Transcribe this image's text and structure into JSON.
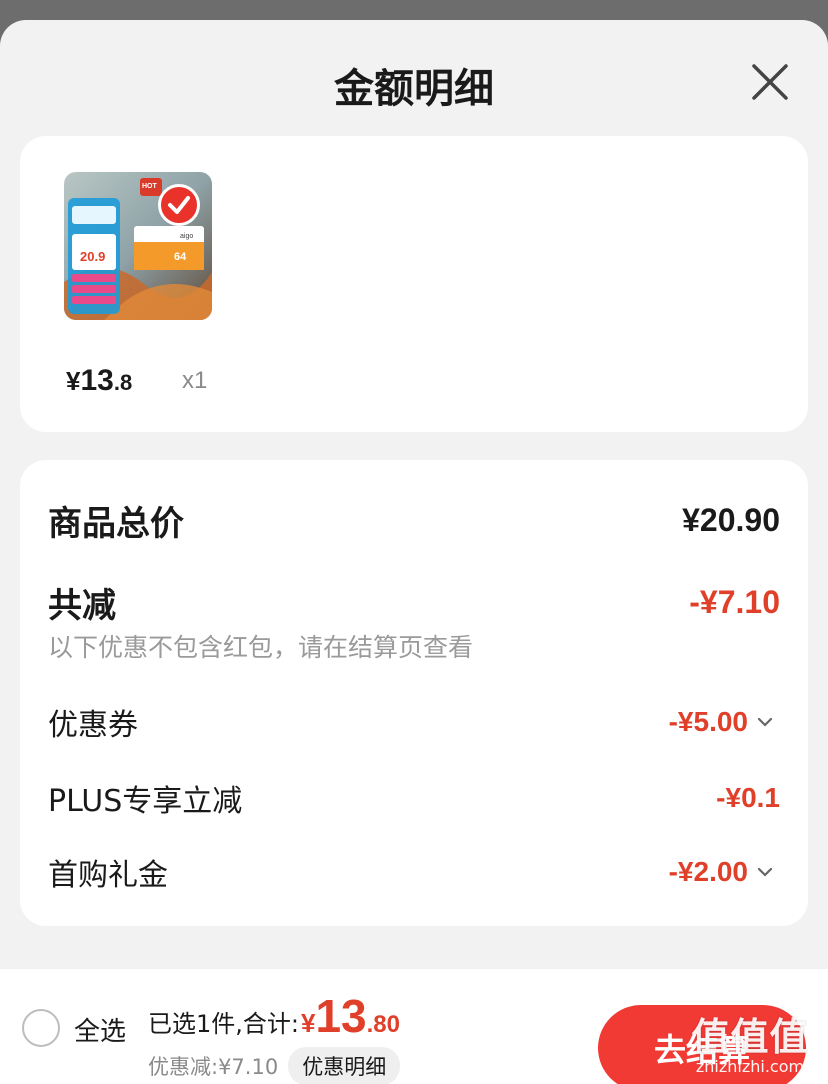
{
  "header": {
    "title": "金额明细"
  },
  "product": {
    "image_texts": {
      "hot": "HOT",
      "price": "20.9",
      "brand": "aigo",
      "size": "64"
    },
    "price_yen": "¥",
    "price_int": "13",
    "price_dec": ".8",
    "quantity": "x1"
  },
  "summary": {
    "total_label": "商品总价",
    "total_value": "¥20.90",
    "reduction_label": "共减",
    "reduction_value": "-¥7.10",
    "note": "以下优惠不包含红包，请在结算页查看",
    "items": [
      {
        "label": "优惠券",
        "value": "-¥5.00",
        "expandable": true
      },
      {
        "label": "PLUS专享立减",
        "value": "-¥0.1",
        "expandable": false
      },
      {
        "label": "首购礼金",
        "value": "-¥2.00",
        "expandable": true
      }
    ]
  },
  "bottom_bar": {
    "select_all": "全选",
    "total_label": "已选1件,合计:",
    "total_yen": "¥",
    "total_int": "13",
    "total_dec": ".80",
    "discount_text": "优惠减:¥7.10",
    "detail_label": "优惠明细",
    "checkout_label": "去结算"
  },
  "watermark": {
    "logo": "值值值",
    "url": "zhizhizhi.com"
  },
  "colors": {
    "accent_red": "#e0402a",
    "checkout_red": "#f23a35",
    "overlay": "#6d6d6d",
    "sheet_bg": "#f2f2f2"
  }
}
